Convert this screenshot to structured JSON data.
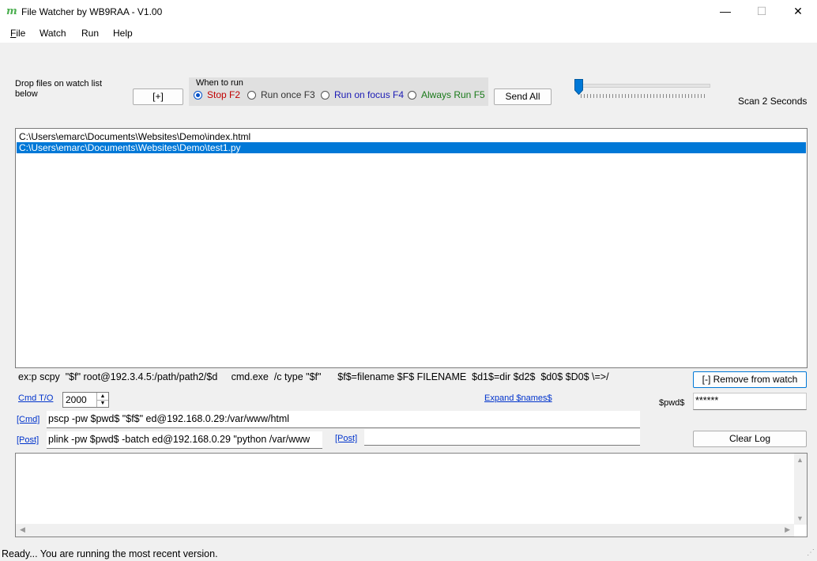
{
  "window": {
    "app_icon_glyph": "m",
    "title": "File Watcher by WB9RAA - V1.00",
    "minimize_glyph": "—",
    "maximize_glyph": "☐",
    "close_glyph": "✕"
  },
  "menu": {
    "file_first": "F",
    "file_rest": "ile",
    "watch": "Watch",
    "run": "Run",
    "help": "Help"
  },
  "controls": {
    "drop_label": "Drop files on watch list below",
    "add_button": "[+]",
    "when_to_run_title": "When to run",
    "radios": [
      {
        "label": "Stop F2",
        "color": "#c00000",
        "checked": true
      },
      {
        "label": "Run once F3",
        "color": "#333333",
        "checked": false
      },
      {
        "label": "Run on focus F4",
        "color": "#1a1ab4",
        "checked": false
      },
      {
        "label": "Always Run F5",
        "color": "#1a7a1a",
        "checked": false
      }
    ],
    "send_all_button": "Send All",
    "slider_level": 0.0,
    "scan_label": "Scan 2 Seconds"
  },
  "watch_list": {
    "items": [
      {
        "path": "C:\\Users\\emarc\\Documents\\Websites\\Demo\\index.html",
        "selected": false
      },
      {
        "path": "C:\\Users\\emarc\\Documents\\Websites\\Demo\\test1.py",
        "selected": true
      }
    ]
  },
  "help_line": "ex:p scpy  \"$f\" root@192.3.4.5:/path/path2/$d     cmd.exe  /c type \"$f\"      $f$=filename $F$ FILENAME  $d1$=dir $d2$  $d0$ $D0$ \\=>/",
  "remove_button": "[-] Remove from watch",
  "cmd_timeout": {
    "label": "Cmd T/O",
    "value": "2000"
  },
  "expand_names_link": "Expand $names$",
  "pwd": {
    "label": "$pwd$",
    "value": "******"
  },
  "cmd": {
    "label": "[Cmd]",
    "value": "pscp  -pw $pwd$ \"$f$\"  ed@192.168.0.29:/var/www/html"
  },
  "post": {
    "label": "[Post]",
    "value": "plink -pw $pwd$ -batch ed@192.168.0.29 \"python /var/www",
    "label2": "[Post]",
    "value2": ""
  },
  "clear_log_button": "Clear Log",
  "log": {
    "text": ""
  },
  "status": "Ready... You are running the most recent version."
}
